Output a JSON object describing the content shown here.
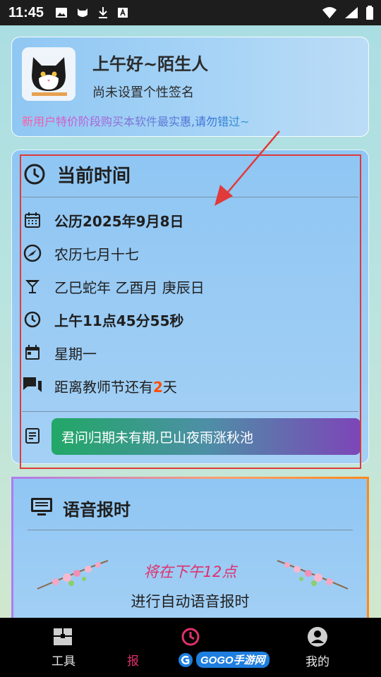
{
  "status_bar": {
    "time": "11:45"
  },
  "profile": {
    "greeting": "上午好~陌生人",
    "signature": "尚未设置个性签名",
    "promo": "新用户特价阶段购买本软件最实惠,请勿错过~"
  },
  "time_card": {
    "title": "当前时间",
    "solar_date": "公历2025年9月8日",
    "lunar_date": "农历七月十七",
    "ganzhi": "乙巳蛇年 乙酉月 庚辰日",
    "clock": "上午11点45分55秒",
    "weekday": "星期一",
    "countdown_prefix": "距离教师节还有",
    "countdown_days": "2",
    "countdown_suffix": "天",
    "poem": "君问归期未有期,巴山夜雨涨秋池"
  },
  "voice_card": {
    "title": "语音报时",
    "next_time": "将在下午12点",
    "description": "进行自动语音报时"
  },
  "bottom_nav": {
    "items": [
      {
        "label": "工具",
        "icon": "toolbox-icon"
      },
      {
        "label": "报",
        "icon": "clock-icon"
      },
      {
        "label": "我的",
        "icon": "account-icon"
      }
    ]
  },
  "watermark": {
    "prefix": "GOGO",
    "suffix": "手游网"
  },
  "colors": {
    "accent": "#e0306e",
    "highlight": "#ff4d00",
    "annotation": "#e03a3a"
  }
}
